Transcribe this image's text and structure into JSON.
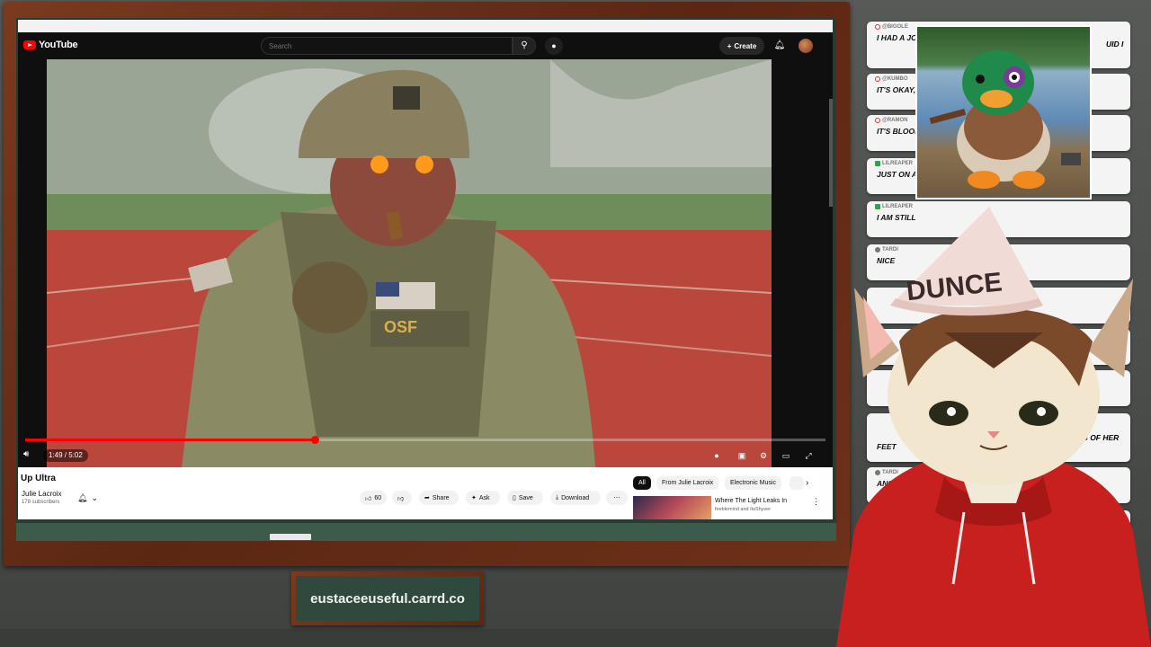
{
  "overlay": {
    "url_plate": "eustaceeuseful.carrd.co"
  },
  "browser": {
    "logo_text": "YouTube",
    "search_placeholder": "Search",
    "create_label": "Create"
  },
  "player": {
    "time": "1:49 / 5:02",
    "progress": 0.362
  },
  "video": {
    "title": "Up Ultra",
    "channel": "Julie Lacroix",
    "subscribers": "178 subscribers",
    "likes": "60",
    "actions": [
      "Share",
      "Ask",
      "Save",
      "Download"
    ]
  },
  "chips": [
    "All",
    "From Julie Lacroix",
    "Electronic Music"
  ],
  "recommendation": {
    "title": "Where The Light Leaks In",
    "subtitle": "feeblemind and ItsShyver"
  },
  "chat": [
    {
      "user": "@BIGOLE",
      "message": "I HAD A JOK… TOLD HER I'",
      "tail": "UID I"
    },
    {
      "user": "@KUMBO",
      "message": "IT'S OKAY, I"
    },
    {
      "user": "@RAMON",
      "message": "IT'S BLOOP"
    },
    {
      "user": "LILREAPER",
      "message": "JUST ON A D"
    },
    {
      "user": "LILREAPER",
      "message": "I AM STILL"
    },
    {
      "user": "TARDI",
      "message": "NICE"
    },
    {
      "user": "",
      "message": ""
    },
    {
      "user": "",
      "message": ""
    },
    {
      "user": "",
      "message": ""
    },
    {
      "user": "",
      "message": "FEET",
      "tail": "PICS OF HER"
    },
    {
      "user": "TARDI",
      "message": "ANG"
    },
    {
      "user": "",
      "message": ""
    }
  ],
  "hat_text": "DUNCE",
  "colors": {
    "youtube_red": "#ff0000",
    "chalkboard": "#2f4a3c",
    "frame_wood": "#6e3119",
    "hoodie": "#c8201e"
  }
}
